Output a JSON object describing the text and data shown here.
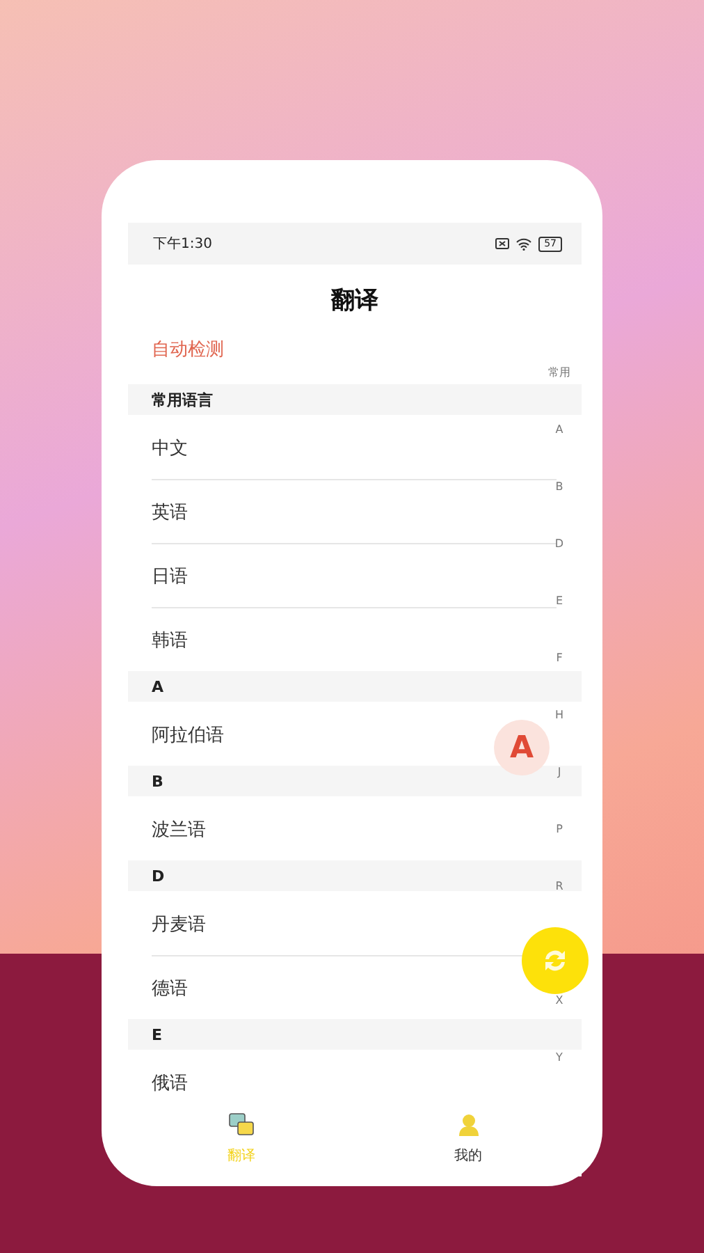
{
  "status_bar": {
    "time": "下午1:30",
    "battery": "57"
  },
  "title": "翻译",
  "auto_detect": "自动检测",
  "sections": [
    {
      "header": "常用语言",
      "items": [
        "中文",
        "英语",
        "日语",
        "韩语"
      ]
    },
    {
      "header": "A",
      "items": [
        "阿拉伯语"
      ]
    },
    {
      "header": "B",
      "items": [
        "波兰语"
      ]
    },
    {
      "header": "D",
      "items": [
        "丹麦语",
        "德语"
      ]
    },
    {
      "header": "E",
      "items": [
        "俄语"
      ]
    }
  ],
  "index_bar": [
    "常用",
    "A",
    "B",
    "D",
    "E",
    "F",
    "H",
    "J",
    "P",
    "R",
    "X",
    "Y"
  ],
  "letter_popup": "A",
  "tabs": [
    {
      "label": "翻译",
      "selected": true
    },
    {
      "label": "我的",
      "selected": false
    }
  ]
}
